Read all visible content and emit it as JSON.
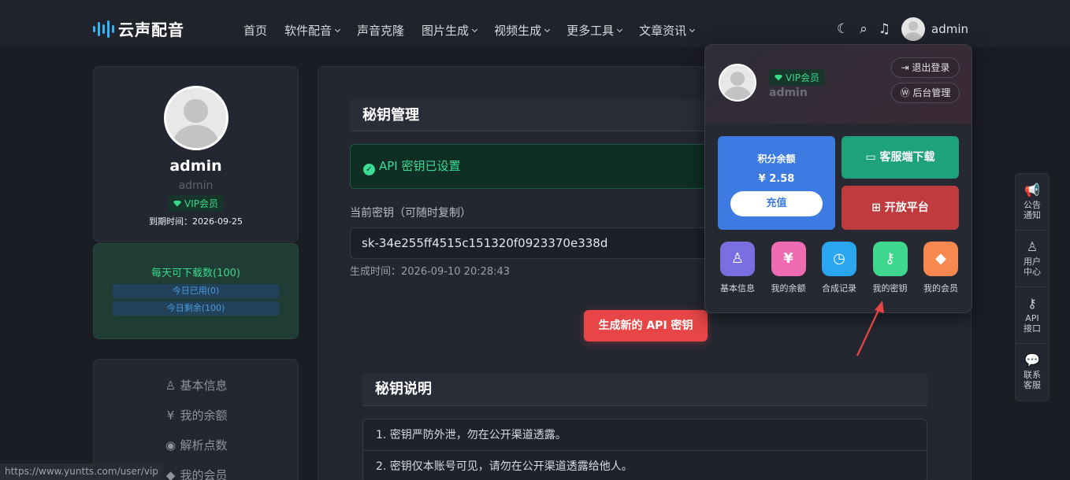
{
  "nav": {
    "logo_text": "云声配音",
    "menu": [
      "首页",
      "软件配音",
      "声音克隆",
      "图片生成",
      "视频生成",
      "更多工具",
      "文章资讯"
    ],
    "menu_has_caret": [
      false,
      true,
      false,
      true,
      true,
      true,
      true
    ],
    "username": "admin",
    "icons": [
      "moon-icon",
      "search-icon",
      "bell-icon"
    ]
  },
  "profile": {
    "name": "admin",
    "sub": "admin",
    "vip": "VIP会员",
    "expire": "到期时间：2026-09-25"
  },
  "download": {
    "title": "每天可下载数(100)",
    "used": "今日已用(0)",
    "remaining": "今日剩余(100)"
  },
  "side_menu": [
    {
      "icon": "user-icon",
      "glyph": "♙",
      "label": "基本信息"
    },
    {
      "icon": "yen-icon",
      "glyph": "¥",
      "label": "我的余额"
    },
    {
      "icon": "coins-icon",
      "glyph": "◉",
      "label": "解析点数"
    },
    {
      "icon": "diamond-icon",
      "glyph": "◆",
      "label": "我的会员"
    }
  ],
  "main": {
    "section_title": "秘钥管理",
    "alert": "API 密钥已设置",
    "key_label": "当前密钥（可随时复制）",
    "key_value": "sk-34e255ff4515c151320f0923370e338d",
    "gen_time": "生成时间：2026-09-10 20:28:43",
    "gen_button": "生成新的 API 密钥",
    "notes_title": "秘钥说明",
    "notes": [
      "1. 密钥严防外泄，勿在公开渠道透露。",
      "2. 密钥仅本账号可见，请勿在公开渠道透露给他人。"
    ]
  },
  "dropdown": {
    "vip": "VIP会员",
    "name": "admin",
    "logout": "退出登录",
    "admin_panel": "后台管理",
    "balance_label": "积分余额",
    "balance_value": "¥ 2.58",
    "recharge": "充值",
    "client_download": "客服端下载",
    "open_platform": "开放平台",
    "quick": [
      {
        "label": "基本信息",
        "icon": "user-icon",
        "glyph": "♙",
        "color": "#7a6fe0"
      },
      {
        "label": "我的余额",
        "icon": "yen-icon",
        "glyph": "¥",
        "color": "#f06bb2"
      },
      {
        "label": "合成记录",
        "icon": "clock-icon",
        "glyph": "◷",
        "color": "#2aa5ef"
      },
      {
        "label": "我的密钥",
        "icon": "key-icon",
        "glyph": "⚷",
        "color": "#3ed78d"
      },
      {
        "label": "我的会员",
        "icon": "diamond-icon",
        "glyph": "◆",
        "color": "#f7884f"
      }
    ]
  },
  "float_bar": [
    {
      "icon": "megaphone-icon",
      "glyph": "📢",
      "label": "公告通知"
    },
    {
      "icon": "user-icon",
      "glyph": "♙",
      "label": "用户中心"
    },
    {
      "icon": "key-icon",
      "glyph": "⚷",
      "label": "API接口"
    },
    {
      "icon": "wechat-icon",
      "glyph": "💬",
      "label": "联系客服"
    }
  ],
  "status_url": "https://www.yuntts.com/user/vip",
  "colors": {
    "accent_red": "#e84646",
    "accent_green": "#39d98a",
    "accent_blue": "#3d7be2"
  }
}
